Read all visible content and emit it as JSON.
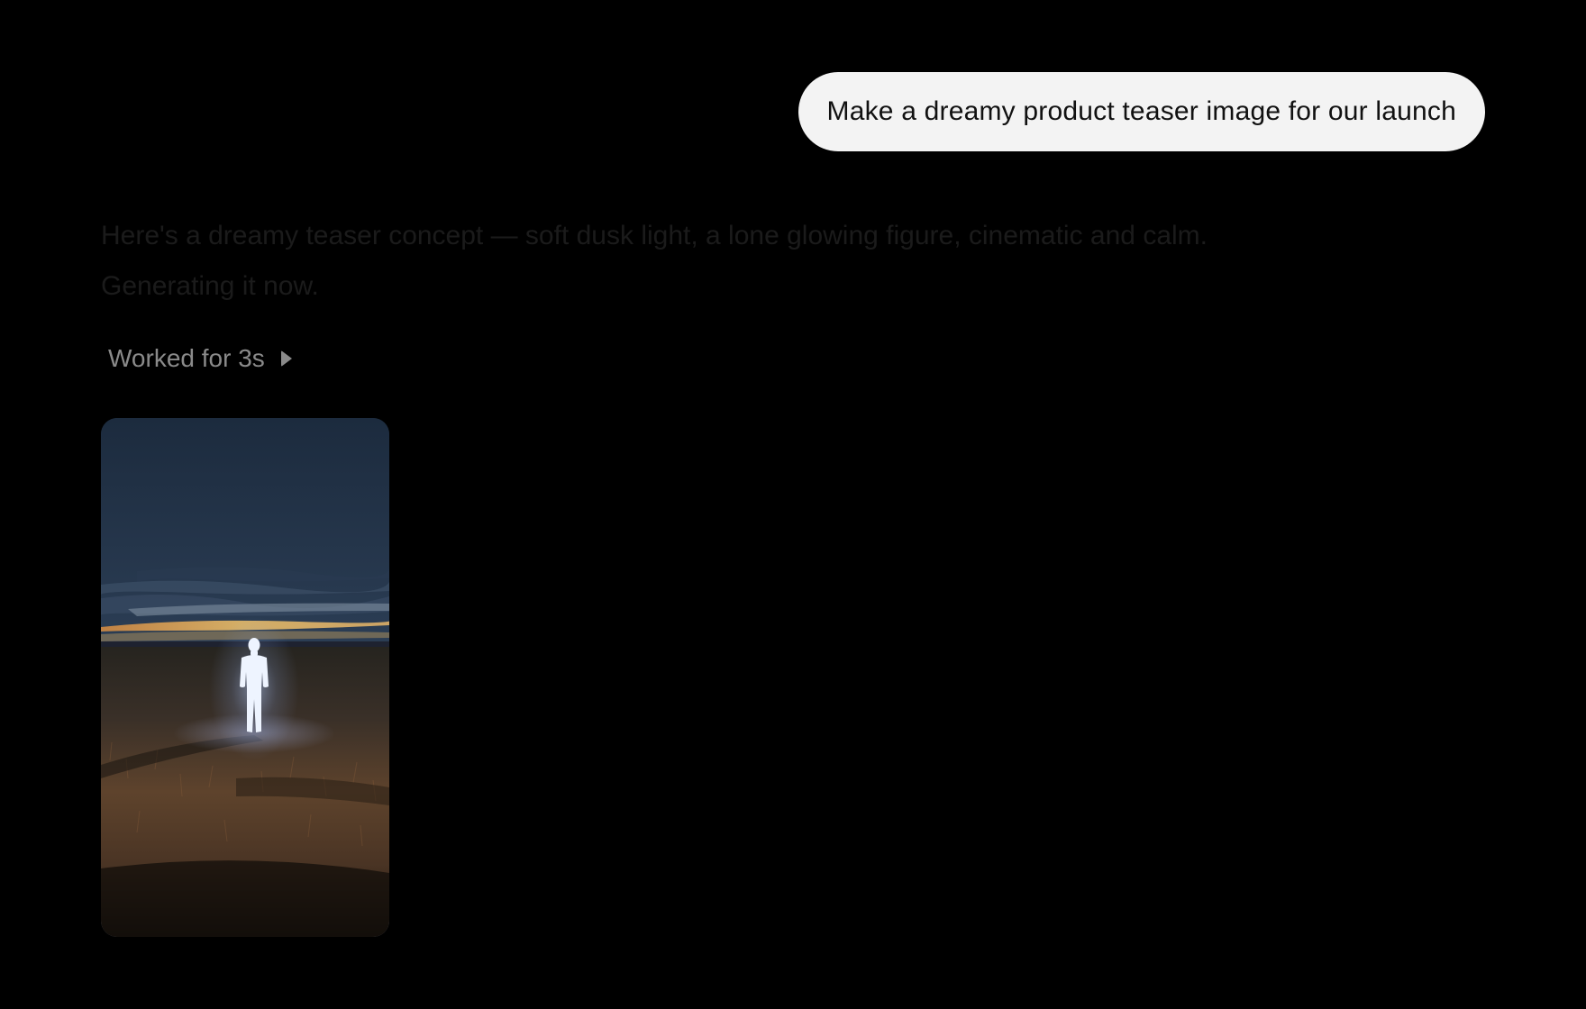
{
  "user_message": {
    "text": "Make a dreamy product teaser image for our launch"
  },
  "assistant_message": {
    "line1": "Here's a dreamy teaser concept — soft dusk light, a lone glowing figure, cinematic and calm.",
    "line2": "Generating it now."
  },
  "worked_indicator": {
    "label": "Worked for 3s",
    "icon": "play-triangle-icon"
  },
  "generated_image": {
    "subject": "glowing figure in a field at dusk",
    "colors": {
      "sky_top": "#1c2b3e",
      "sky_mid": "#34475e",
      "horizon_glow": "#f0b45a",
      "field_dark": "#1a140e",
      "field_warm": "#6b4a2c",
      "figure_glow": "#e6f0ff"
    }
  }
}
